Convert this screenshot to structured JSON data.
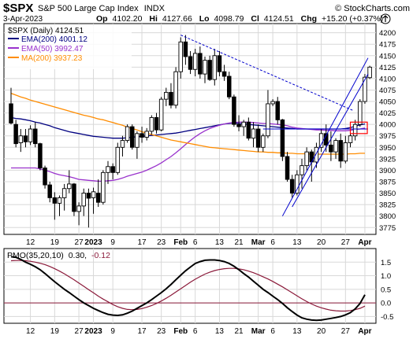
{
  "header": {
    "symbol": "$SPX",
    "name": "S&P 500 Large Cap Index",
    "exchange": "INDX",
    "copyright": "© StockCharts.com",
    "date": "3-Apr-2023",
    "open_label": "Op",
    "open": "4102.20",
    "high_label": "Hi",
    "high": "4127.66",
    "low_label": "Lo",
    "low": "4098.79",
    "close_label": "Cl",
    "close": "4124.51",
    "change_label": "Chg",
    "change": "+15.20 (+0.37%)",
    "trend_arrow": "up-arrow-icon"
  },
  "legend": [
    {
      "label": "EMA(200) 4001.12",
      "color": "#000080"
    },
    {
      "label": "EMA(50) 3992.47",
      "color": "#9932cc"
    },
    {
      "label": "MA(200) 3937.23",
      "color": "#ff8c00"
    },
    {
      "label": "$SPX (Daily) 4124.51",
      "color": "#000000"
    }
  ],
  "indicator": {
    "label": "PMO(35,20,10)",
    "value": "0.30,",
    "signal": "-0.12",
    "line_color": "#000000",
    "signal_color": "#8b1a3a",
    "zero_color": "#8b1a3a"
  },
  "colors": {
    "up_candle": "#ffffff",
    "down_candle": "#000000",
    "grid": "#d8d8d8",
    "plot_bg": "#ffffff",
    "trendline": "#0000cc",
    "highlight_box": "#ff0000"
  },
  "chart_data": [
    {
      "type": "candlestick",
      "title": "$SPX S&P 500 Large Cap Index INDX",
      "ylim": [
        3760,
        4220
      ],
      "y_ticks": [
        3775,
        3800,
        3825,
        3850,
        3875,
        3900,
        3925,
        3950,
        3975,
        4000,
        4025,
        4050,
        4075,
        4100,
        4125,
        4150,
        4175,
        4200
      ],
      "x_ticks": [
        {
          "label": "12",
          "bold": false
        },
        {
          "label": "19",
          "bold": false
        },
        {
          "label": "27",
          "bold": false
        },
        {
          "label": "2023",
          "bold": true
        },
        {
          "label": "9",
          "bold": false
        },
        {
          "label": "17",
          "bold": false
        },
        {
          "label": "23",
          "bold": false
        },
        {
          "label": "Feb",
          "bold": true
        },
        {
          "label": "6",
          "bold": false
        },
        {
          "label": "13",
          "bold": false
        },
        {
          "label": "21",
          "bold": false
        },
        {
          "label": "Mar",
          "bold": true
        },
        {
          "label": "6",
          "bold": false
        },
        {
          "label": "13",
          "bold": false
        },
        {
          "label": "20",
          "bold": false
        },
        {
          "label": "27",
          "bold": false
        },
        {
          "label": "Apr",
          "bold": true
        }
      ],
      "x_tick_bars": [
        4,
        9,
        14,
        17,
        21,
        27,
        31,
        35,
        38,
        43,
        47,
        51,
        54,
        59,
        64,
        69,
        73
      ],
      "grid": true,
      "bars": [
        {
          "o": 4045,
          "h": 4080,
          "l": 4000,
          "c": 4003
        },
        {
          "o": 4000,
          "h": 4010,
          "l": 3950,
          "c": 3958
        },
        {
          "o": 3960,
          "h": 3990,
          "l": 3940,
          "c": 3975
        },
        {
          "o": 3975,
          "h": 3990,
          "l": 3950,
          "c": 3962
        },
        {
          "o": 3962,
          "h": 3998,
          "l": 3955,
          "c": 3990
        },
        {
          "o": 3990,
          "h": 4005,
          "l": 3950,
          "c": 3958
        },
        {
          "o": 3958,
          "h": 3960,
          "l": 3900,
          "c": 3905
        },
        {
          "o": 3905,
          "h": 3910,
          "l": 3860,
          "c": 3868
        },
        {
          "o": 3868,
          "h": 3875,
          "l": 3830,
          "c": 3840
        },
        {
          "o": 3840,
          "h": 3852,
          "l": 3792,
          "c": 3828
        },
        {
          "o": 3828,
          "h": 3845,
          "l": 3800,
          "c": 3840
        },
        {
          "o": 3840,
          "h": 3870,
          "l": 3812,
          "c": 3860
        },
        {
          "o": 3860,
          "h": 3900,
          "l": 3850,
          "c": 3870
        },
        {
          "o": 3870,
          "h": 3872,
          "l": 3800,
          "c": 3810
        },
        {
          "o": 3810,
          "h": 3830,
          "l": 3780,
          "c": 3822
        },
        {
          "o": 3822,
          "h": 3860,
          "l": 3800,
          "c": 3850
        },
        {
          "o": 3850,
          "h": 3860,
          "l": 3775,
          "c": 3839
        },
        {
          "o": 3840,
          "h": 3862,
          "l": 3805,
          "c": 3853
        },
        {
          "o": 3850,
          "h": 3880,
          "l": 3820,
          "c": 3830
        },
        {
          "o": 3830,
          "h": 3900,
          "l": 3825,
          "c": 3895
        },
        {
          "o": 3895,
          "h": 3920,
          "l": 3870,
          "c": 3908
        },
        {
          "o": 3908,
          "h": 3915,
          "l": 3880,
          "c": 3895
        },
        {
          "o": 3895,
          "h": 3960,
          "l": 3890,
          "c": 3950
        },
        {
          "o": 3950,
          "h": 3975,
          "l": 3930,
          "c": 3965
        },
        {
          "o": 3965,
          "h": 4000,
          "l": 3960,
          "c": 3995
        },
        {
          "o": 3995,
          "h": 4000,
          "l": 3945,
          "c": 3950
        },
        {
          "o": 3950,
          "h": 3985,
          "l": 3925,
          "c": 3980
        },
        {
          "o": 3980,
          "h": 3995,
          "l": 3960,
          "c": 3972
        },
        {
          "o": 3972,
          "h": 3992,
          "l": 3965,
          "c": 3985
        },
        {
          "o": 3985,
          "h": 4020,
          "l": 3978,
          "c": 4015
        },
        {
          "o": 4015,
          "h": 4025,
          "l": 3980,
          "c": 3988
        },
        {
          "o": 3988,
          "h": 4060,
          "l": 3985,
          "c": 4055
        },
        {
          "o": 4055,
          "h": 4080,
          "l": 4040,
          "c": 4070
        },
        {
          "o": 4070,
          "h": 4090,
          "l": 4035,
          "c": 4042
        },
        {
          "o": 4042,
          "h": 4125,
          "l": 4035,
          "c": 4115
        },
        {
          "o": 4115,
          "h": 4190,
          "l": 4100,
          "c": 4180
        },
        {
          "o": 4180,
          "h": 4195,
          "l": 4130,
          "c": 4148
        },
        {
          "o": 4148,
          "h": 4160,
          "l": 4110,
          "c": 4120
        },
        {
          "o": 4120,
          "h": 4165,
          "l": 4105,
          "c": 4155
        },
        {
          "o": 4155,
          "h": 4170,
          "l": 4100,
          "c": 4110
        },
        {
          "o": 4110,
          "h": 4148,
          "l": 4090,
          "c": 4140
        },
        {
          "o": 4140,
          "h": 4150,
          "l": 4095,
          "c": 4098
        },
        {
          "o": 4098,
          "h": 4165,
          "l": 4085,
          "c": 4150
        },
        {
          "o": 4150,
          "h": 4160,
          "l": 4105,
          "c": 4115
        },
        {
          "o": 4115,
          "h": 4130,
          "l": 4095,
          "c": 4105
        },
        {
          "o": 4105,
          "h": 4115,
          "l": 4055,
          "c": 4060
        },
        {
          "o": 4060,
          "h": 4065,
          "l": 3995,
          "c": 4000
        },
        {
          "o": 4000,
          "h": 4020,
          "l": 3985,
          "c": 3995
        },
        {
          "o": 3995,
          "h": 4010,
          "l": 3975,
          "c": 4005
        },
        {
          "o": 4005,
          "h": 4015,
          "l": 3965,
          "c": 3970
        },
        {
          "o": 3970,
          "h": 4005,
          "l": 3950,
          "c": 3990
        },
        {
          "o": 3990,
          "h": 4000,
          "l": 3940,
          "c": 3950
        },
        {
          "o": 3950,
          "h": 3980,
          "l": 3940,
          "c": 3975
        },
        {
          "o": 3975,
          "h": 4075,
          "l": 3970,
          "c": 4045
        },
        {
          "o": 4045,
          "h": 4055,
          "l": 4040,
          "c": 4050
        },
        {
          "o": 4050,
          "h": 4060,
          "l": 4000,
          "c": 4010
        },
        {
          "o": 4010,
          "h": 4012,
          "l": 3920,
          "c": 3930
        },
        {
          "o": 3930,
          "h": 3940,
          "l": 3875,
          "c": 3880
        },
        {
          "o": 3880,
          "h": 3890,
          "l": 3840,
          "c": 3850
        },
        {
          "o": 3850,
          "h": 3900,
          "l": 3845,
          "c": 3890
        },
        {
          "o": 3890,
          "h": 3925,
          "l": 3860,
          "c": 3910
        },
        {
          "o": 3910,
          "h": 3950,
          "l": 3900,
          "c": 3940
        },
        {
          "o": 3940,
          "h": 3945,
          "l": 3875,
          "c": 3918
        },
        {
          "o": 3918,
          "h": 3960,
          "l": 3905,
          "c": 3950
        },
        {
          "o": 3950,
          "h": 3990,
          "l": 3940,
          "c": 3980
        },
        {
          "o": 3980,
          "h": 4000,
          "l": 3940,
          "c": 3955
        },
        {
          "o": 3955,
          "h": 3985,
          "l": 3920,
          "c": 3940
        },
        {
          "o": 3940,
          "h": 3970,
          "l": 3925,
          "c": 3965
        },
        {
          "o": 3965,
          "h": 3980,
          "l": 3905,
          "c": 3920
        },
        {
          "o": 3920,
          "h": 3975,
          "l": 3915,
          "c": 3960
        },
        {
          "o": 3960,
          "h": 3985,
          "l": 3950,
          "c": 3975
        },
        {
          "o": 3975,
          "h": 4010,
          "l": 3965,
          "c": 4000
        },
        {
          "o": 4000,
          "h": 4055,
          "l": 3995,
          "c": 4050
        },
        {
          "o": 4050,
          "h": 4110,
          "l": 4045,
          "c": 4103
        },
        {
          "o": 4102,
          "h": 4128,
          "l": 4099,
          "c": 4125
        }
      ],
      "overlays": [
        {
          "name": "EMA(200)",
          "color": "#000080",
          "values": [
            4015,
            4013,
            4012,
            4010,
            4008,
            4005,
            4003,
            4000,
            3997,
            3993,
            3990,
            3987,
            3984,
            3982,
            3980,
            3978,
            3976,
            3974,
            3973,
            3972,
            3971,
            3970,
            3970,
            3970,
            3971,
            3972,
            3973,
            3974,
            3975,
            3976,
            3977,
            3978,
            3979,
            3980,
            3981,
            3983,
            3985,
            3987,
            3989,
            3991,
            3993,
            3995,
            3997,
            3999,
            4001,
            4002,
            4003,
            4002,
            4001,
            4000,
            3999,
            3998,
            3997,
            3996,
            3995,
            3994,
            3993,
            3992,
            3991,
            3990,
            3990,
            3990,
            3990,
            3990,
            3990,
            3990,
            3990,
            3990,
            3990,
            3991,
            3993,
            3996,
            3999,
            4001
          ]
        },
        {
          "name": "EMA(50)",
          "color": "#9932cc",
          "values": [
            3905,
            3905,
            3905,
            3905,
            3905,
            3905,
            3903,
            3900,
            3897,
            3893,
            3890,
            3888,
            3886,
            3883,
            3880,
            3879,
            3878,
            3877,
            3876,
            3876,
            3877,
            3878,
            3880,
            3883,
            3887,
            3890,
            3893,
            3896,
            3900,
            3905,
            3910,
            3916,
            3923,
            3930,
            3938,
            3947,
            3956,
            3965,
            3973,
            3980,
            3986,
            3991,
            3995,
            3998,
            4001,
            4003,
            4004,
            4005,
            4005,
            4005,
            4004,
            4003,
            4002,
            4002,
            4001,
            4000,
            3999,
            3997,
            3994,
            3992,
            3991,
            3990,
            3989,
            3988,
            3988,
            3987,
            3987,
            3986,
            3986,
            3986,
            3987,
            3989,
            3990,
            3992
          ]
        },
        {
          "name": "MA(200)",
          "color": "#ff8c00",
          "values": [
            4068,
            4064,
            4060,
            4057,
            4053,
            4050,
            4047,
            4044,
            4041,
            4038,
            4035,
            4032,
            4029,
            4026,
            4023,
            4020,
            4018,
            4015,
            4012,
            4010,
            4007,
            4004,
            4001,
            3998,
            3994,
            3991,
            3988,
            3984,
            3981,
            3978,
            3975,
            3972,
            3969,
            3966,
            3964,
            3962,
            3960,
            3958,
            3956,
            3954,
            3952,
            3950,
            3949,
            3948,
            3947,
            3946,
            3945,
            3944,
            3943,
            3942,
            3941,
            3940,
            3940,
            3939,
            3939,
            3938,
            3938,
            3937,
            3937,
            3936,
            3936,
            3936,
            3935,
            3935,
            3935,
            3935,
            3935,
            3935,
            3935,
            3935,
            3936,
            3936,
            3937,
            3937
          ]
        }
      ],
      "trendlines": [
        {
          "bar_from": 35,
          "y_from": 4195,
          "bar_to": 70,
          "y_to": 4030
        },
        {
          "bar_from": 56,
          "y_from": 3800,
          "bar_to": 73,
          "y_to": 4145
        },
        {
          "bar_from": 58,
          "y_from": 3820,
          "bar_to": 73,
          "y_to": 4110
        },
        {
          "bar_from": 52,
          "y_from": 3990,
          "bar_to": 73,
          "y_to": 3990
        }
      ],
      "highlight_box": {
        "bar_from": 70,
        "bar_to": 73.5,
        "y_from": 3980,
        "y_to": 4005
      }
    },
    {
      "type": "line",
      "title": "PMO(35,20,10)",
      "ylim": [
        -0.75,
        2.0
      ],
      "y_ticks": [
        1.5,
        1.0,
        0.5,
        0.0,
        -0.5
      ],
      "y_tick_labels": [
        "1.5",
        "1.0",
        "0.5",
        "0.0",
        "-0.5"
      ],
      "zero_line": 0.0,
      "grid": true,
      "series": [
        {
          "name": "PMO",
          "color": "#000000",
          "values": [
            1.7,
            1.68,
            1.6,
            1.5,
            1.42,
            1.33,
            1.22,
            1.08,
            0.93,
            0.78,
            0.64,
            0.5,
            0.38,
            0.25,
            0.12,
            0.0,
            -0.1,
            -0.2,
            -0.28,
            -0.36,
            -0.42,
            -0.45,
            -0.46,
            -0.44,
            -0.38,
            -0.3,
            -0.2,
            -0.1,
            0.0,
            0.12,
            0.25,
            0.38,
            0.52,
            0.68,
            0.85,
            1.02,
            1.18,
            1.32,
            1.45,
            1.52,
            1.57,
            1.58,
            1.58,
            1.56,
            1.52,
            1.45,
            1.35,
            1.22,
            1.08,
            0.95,
            0.8,
            0.65,
            0.5,
            0.38,
            0.25,
            0.12,
            -0.02,
            -0.18,
            -0.32,
            -0.45,
            -0.55,
            -0.6,
            -0.63,
            -0.64,
            -0.63,
            -0.6,
            -0.57,
            -0.54,
            -0.5,
            -0.44,
            -0.36,
            -0.22,
            -0.02,
            0.3
          ]
        },
        {
          "name": "Signal",
          "color": "#8b1a3a",
          "values": [
            1.55,
            1.56,
            1.56,
            1.55,
            1.53,
            1.5,
            1.46,
            1.41,
            1.34,
            1.26,
            1.17,
            1.07,
            0.96,
            0.85,
            0.73,
            0.61,
            0.49,
            0.37,
            0.25,
            0.14,
            0.04,
            -0.06,
            -0.14,
            -0.2,
            -0.24,
            -0.25,
            -0.24,
            -0.21,
            -0.16,
            -0.1,
            -0.02,
            0.07,
            0.17,
            0.28,
            0.4,
            0.52,
            0.64,
            0.76,
            0.87,
            0.97,
            1.06,
            1.13,
            1.19,
            1.23,
            1.26,
            1.27,
            1.27,
            1.25,
            1.22,
            1.17,
            1.11,
            1.04,
            0.96,
            0.88,
            0.79,
            0.69,
            0.59,
            0.48,
            0.37,
            0.26,
            0.15,
            0.05,
            -0.04,
            -0.12,
            -0.18,
            -0.23,
            -0.27,
            -0.29,
            -0.3,
            -0.3,
            -0.28,
            -0.25,
            -0.2,
            -0.12
          ]
        }
      ]
    }
  ]
}
